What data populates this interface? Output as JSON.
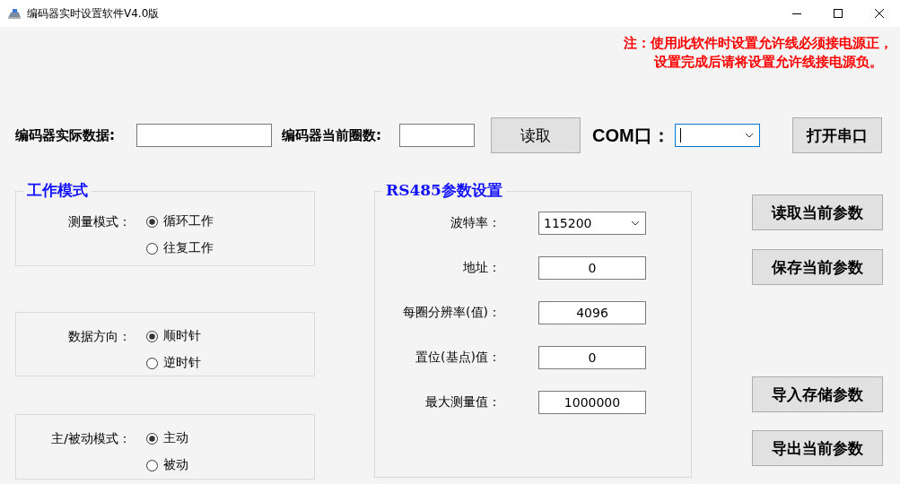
{
  "window": {
    "title": "编码器实时设置软件V4.0版"
  },
  "note": [
    "注：使用此软件时设置允许线必须接电源正，",
    "设置完成后请将设置允许线接电源负。"
  ],
  "top_bar": {
    "actual_data": {
      "label": "编码器实际数据:"
    },
    "current_turns": {
      "label": "编码器当前圈数:"
    },
    "read_button": "读取",
    "com_port": {
      "label": "COM口：",
      "focused": true
    },
    "open_port_button": "打开串口"
  },
  "work_mode": {
    "title": "工作模式",
    "groups": [
      {
        "label": "测量模式：",
        "options": [
          {
            "label": "循环工作",
            "selected": true
          },
          {
            "label": "往复工作",
            "selected": false
          }
        ]
      },
      {
        "label": "数据方向：",
        "options": [
          {
            "label": "顺时针",
            "selected": true
          },
          {
            "label": "逆时针",
            "selected": false
          }
        ]
      },
      {
        "label": "主/被动模式：",
        "options": [
          {
            "label": "主动",
            "selected": true
          },
          {
            "label": "被动",
            "selected": false
          }
        ]
      }
    ]
  },
  "rs485": {
    "title": "RS485参数设置",
    "params": [
      {
        "kind": "select",
        "label": "波特率：",
        "value": "115200"
      },
      {
        "kind": "input",
        "label": "地址：",
        "value": "0"
      },
      {
        "kind": "input",
        "label": "每圈分辨率(值)：",
        "value": "4096"
      },
      {
        "kind": "input",
        "label": "置位(基点)值：",
        "value": "0"
      },
      {
        "kind": "input",
        "label": "最大测量值：",
        "value": "1000000"
      }
    ]
  },
  "actions": [
    "读取当前参数",
    "保存当前参数",
    "导入存储参数",
    "导出当前参数"
  ]
}
